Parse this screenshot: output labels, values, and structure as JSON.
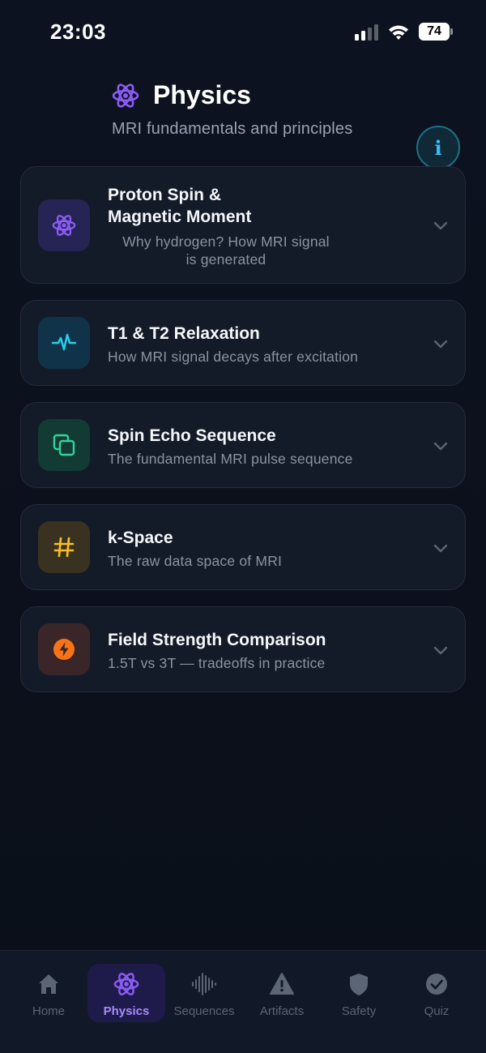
{
  "status_bar": {
    "time": "23:03",
    "battery": "74"
  },
  "header": {
    "title": "Physics",
    "subtitle": "MRI fundamentals and principles",
    "info_label": "i"
  },
  "topics": [
    {
      "title_line1": "Proton Spin &",
      "title_line2": "Magnetic Moment",
      "desc_line1": "Why hydrogen? How MRI signal",
      "desc_line2": "is generated",
      "icon": "atom-icon",
      "color": "#8b5cf6"
    },
    {
      "title": "T1 & T2 Relaxation",
      "desc": "How MRI signal decays after excitation",
      "icon": "pulse-icon",
      "color": "#22d3ee"
    },
    {
      "title": "Spin Echo Sequence",
      "desc": "The fundamental MRI pulse sequence",
      "icon": "layers-icon",
      "color": "#34d399"
    },
    {
      "title": "k-Space",
      "desc": "The raw data space of MRI",
      "icon": "hash-icon",
      "color": "#fbbf24"
    },
    {
      "title": "Field Strength Comparison",
      "desc": "1.5T vs 3T — tradeoffs in practice",
      "icon": "bolt-icon",
      "color": "#f97316"
    }
  ],
  "tabs": [
    {
      "label": "Home",
      "icon": "home-icon"
    },
    {
      "label": "Physics",
      "icon": "atom-icon",
      "active": true
    },
    {
      "label": "Sequences",
      "icon": "waveform-icon"
    },
    {
      "label": "Artifacts",
      "icon": "warning-icon"
    },
    {
      "label": "Safety",
      "icon": "shield-icon"
    },
    {
      "label": "Quiz",
      "icon": "check-circle-icon"
    }
  ],
  "colors": {
    "accent": "#8b5cf6",
    "info": "#38bdf8",
    "background": "#0b101b"
  }
}
